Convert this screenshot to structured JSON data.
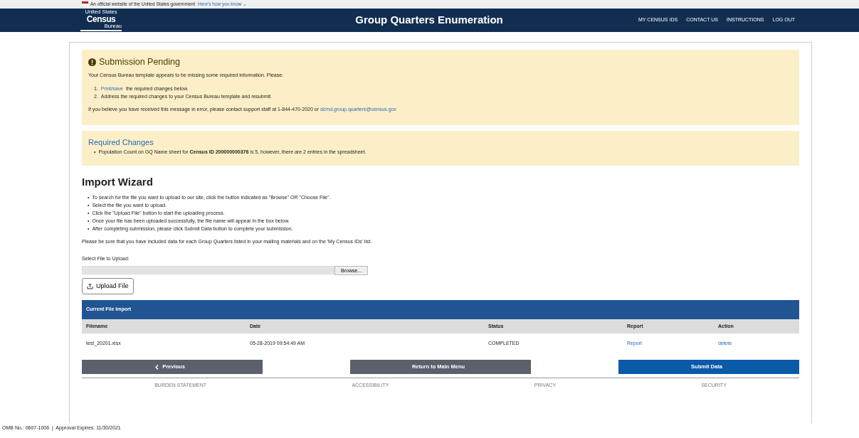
{
  "gov_banner": {
    "text": "An official website of the United States government",
    "link": "Here's how you know ⌄"
  },
  "header": {
    "logo": {
      "top": "United States",
      "main": "Census",
      "bottom": "Bureau"
    },
    "title": "Group Quarters Enumeration",
    "nav": [
      "MY CENSUS IDS",
      "CONTACT US",
      "INSTRUCTIONS",
      "LOG OUT"
    ]
  },
  "pending": {
    "title": "Submission Pending",
    "intro": "Your Census Bureau template appears to be missing some required information. Please:",
    "steps": [
      {
        "number": "1.",
        "link": "Print/save",
        "text": "the required changes below."
      },
      {
        "number": "2.",
        "text": "Address the required changes to your Census Bureau template and resubmit."
      }
    ],
    "contact": "If you believe you have received this message in error, please contact support staff at 1-844-470-2020 or",
    "email": "dcmd.group.quarters@census.gov"
  },
  "required": {
    "title": "Required Changes",
    "marker": "•",
    "items": [
      "Population Count on GQ Name sheet for **Census ID 200000000376** is 5, however, there are 2 entries in the spreadsheet."
    ]
  },
  "wizard": {
    "title": "Import Wizard",
    "marker": "•",
    "steps": [
      "To search for the file you want to upload to our site, click the button indicated as \"Browse\" OR \"Choose File\".",
      "Select the file you want to upload.",
      "Click the \"Upload File\" button to start the uploading process.",
      "Once your file has been uploaded successfully, the file name will appear in the box below.",
      "After completing submission, please click Submit Data button to complete your submission."
    ],
    "note": "Please be sure that you have included data for each Group Quarters listed in your mailing materials and on the 'My Census IDs' list.",
    "file_label": "Select File to Upload:",
    "browse": "Browse...",
    "upload": "Upload File"
  },
  "table": {
    "title": "Current File Import",
    "columns": [
      "Filename",
      "Date",
      "Status",
      "Report",
      "Action"
    ],
    "rows": [
      [
        "test_20201.xlsx",
        "05-28-2019 09:54:49 AM",
        "COMPLETED",
        "Report",
        "delete"
      ]
    ]
  },
  "buttons": [
    {
      "label": "Previous",
      "kind": "back"
    },
    {
      "label": "Return to Main Menu",
      "kind": "secondary"
    },
    {
      "label": "Submit Data",
      "kind": "primary"
    }
  ],
  "footer_links": [
    "BURDEN STATEMENT",
    "ACCESSIBILITY",
    "PRIVACY",
    "SECURITY"
  ],
  "omb": "OMB No.: 0607-1006  |  Approval Expires: 11/30/2021"
}
